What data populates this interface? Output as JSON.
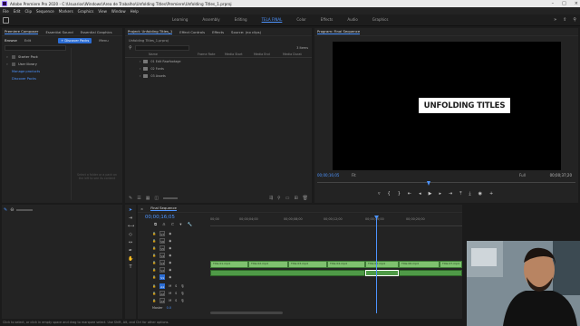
{
  "app": {
    "title": "Adobe Premiere Pro 2020 - C:\\Usuarios\\Windows\\Area de Trabalho\\Unfolding Titles\\Premiere\\Unfolding Titles_1.prproj"
  },
  "menu": [
    "File",
    "Edit",
    "Clip",
    "Sequence",
    "Markers",
    "Graphics",
    "View",
    "Window",
    "Help"
  ],
  "workspaces": {
    "tabs": [
      "Learning",
      "Assembly",
      "Editing",
      "TELA FINAL",
      "Color",
      "Effects",
      "Audio",
      "Graphics"
    ],
    "active": "TELA FINAL"
  },
  "libraries_panel": {
    "tabs": [
      "Premiere Composer",
      "Essential Sound",
      "Essential Graphics"
    ],
    "subtabs": [
      "Browse",
      "Edit"
    ],
    "discover_button": "+ Discover Packs",
    "menu_label": "Menu",
    "items": [
      {
        "label": "Starter Pack",
        "type": "folder"
      },
      {
        "label": "User library",
        "type": "folder"
      },
      {
        "label": "Manage products",
        "type": "link"
      },
      {
        "label": "Discover Packs",
        "type": "link"
      }
    ],
    "hint_text": "Select a folder or a pack on the left to see its content"
  },
  "project_panel": {
    "tabs": [
      "Project: Unfolding Titles_1",
      "Effect Controls",
      "Effects",
      "Source: (no clips)"
    ],
    "file": "Unfolding Titles_1.prproj",
    "item_count": "3 Items",
    "columns": [
      "Name",
      "Frame Rate",
      "Media Start",
      "Media End",
      "Media Durat"
    ],
    "bins": [
      "01 Edit Rawfootage",
      "02 Fonts",
      "03 Assets"
    ]
  },
  "program_monitor": {
    "tab": "Program: Final Sequence",
    "title_card_text": "UNFOLDING TITLES",
    "timecode_current": "00;00;16;05",
    "fit_label": "Fit",
    "quality_label": "Full",
    "timecode_duration": "00;00;37;20"
  },
  "timeline": {
    "tab": "Final Sequence",
    "timecode": "00;00;16;05",
    "ruler_ticks": [
      "00;00",
      "00;00;04;00",
      "00;00;08;00",
      "00;00;12;00",
      "00;00;16;00",
      "00;00;20;00",
      "00;00;24;00",
      "00;00;28;00",
      "00;00;32;00"
    ],
    "video_tracks": [
      "V7",
      "V6",
      "V5",
      "V4",
      "V3",
      "V2",
      "V1"
    ],
    "audio_tracks": [
      "A1",
      "A2",
      "A3"
    ],
    "mix_label": "Master",
    "mix_value": "0.0",
    "v1_clips": [
      "Title 01.mp4",
      "Title 02.mp4",
      "Title 03.mp4",
      "Title 04.mp4",
      "Title 05.mp4",
      "Title 06.mp4",
      "Title 07.mp4"
    ],
    "a1_clip_selected_index": 4
  },
  "statusbar": {
    "text": "Click to select, or click in empty space and drag to marquee select. Use Shift, Alt, and Ctrl for other options."
  },
  "colors": {
    "accent": "#4d94ff",
    "video_clip": "#7fc26f",
    "audio_clip": "#4f9a47"
  }
}
